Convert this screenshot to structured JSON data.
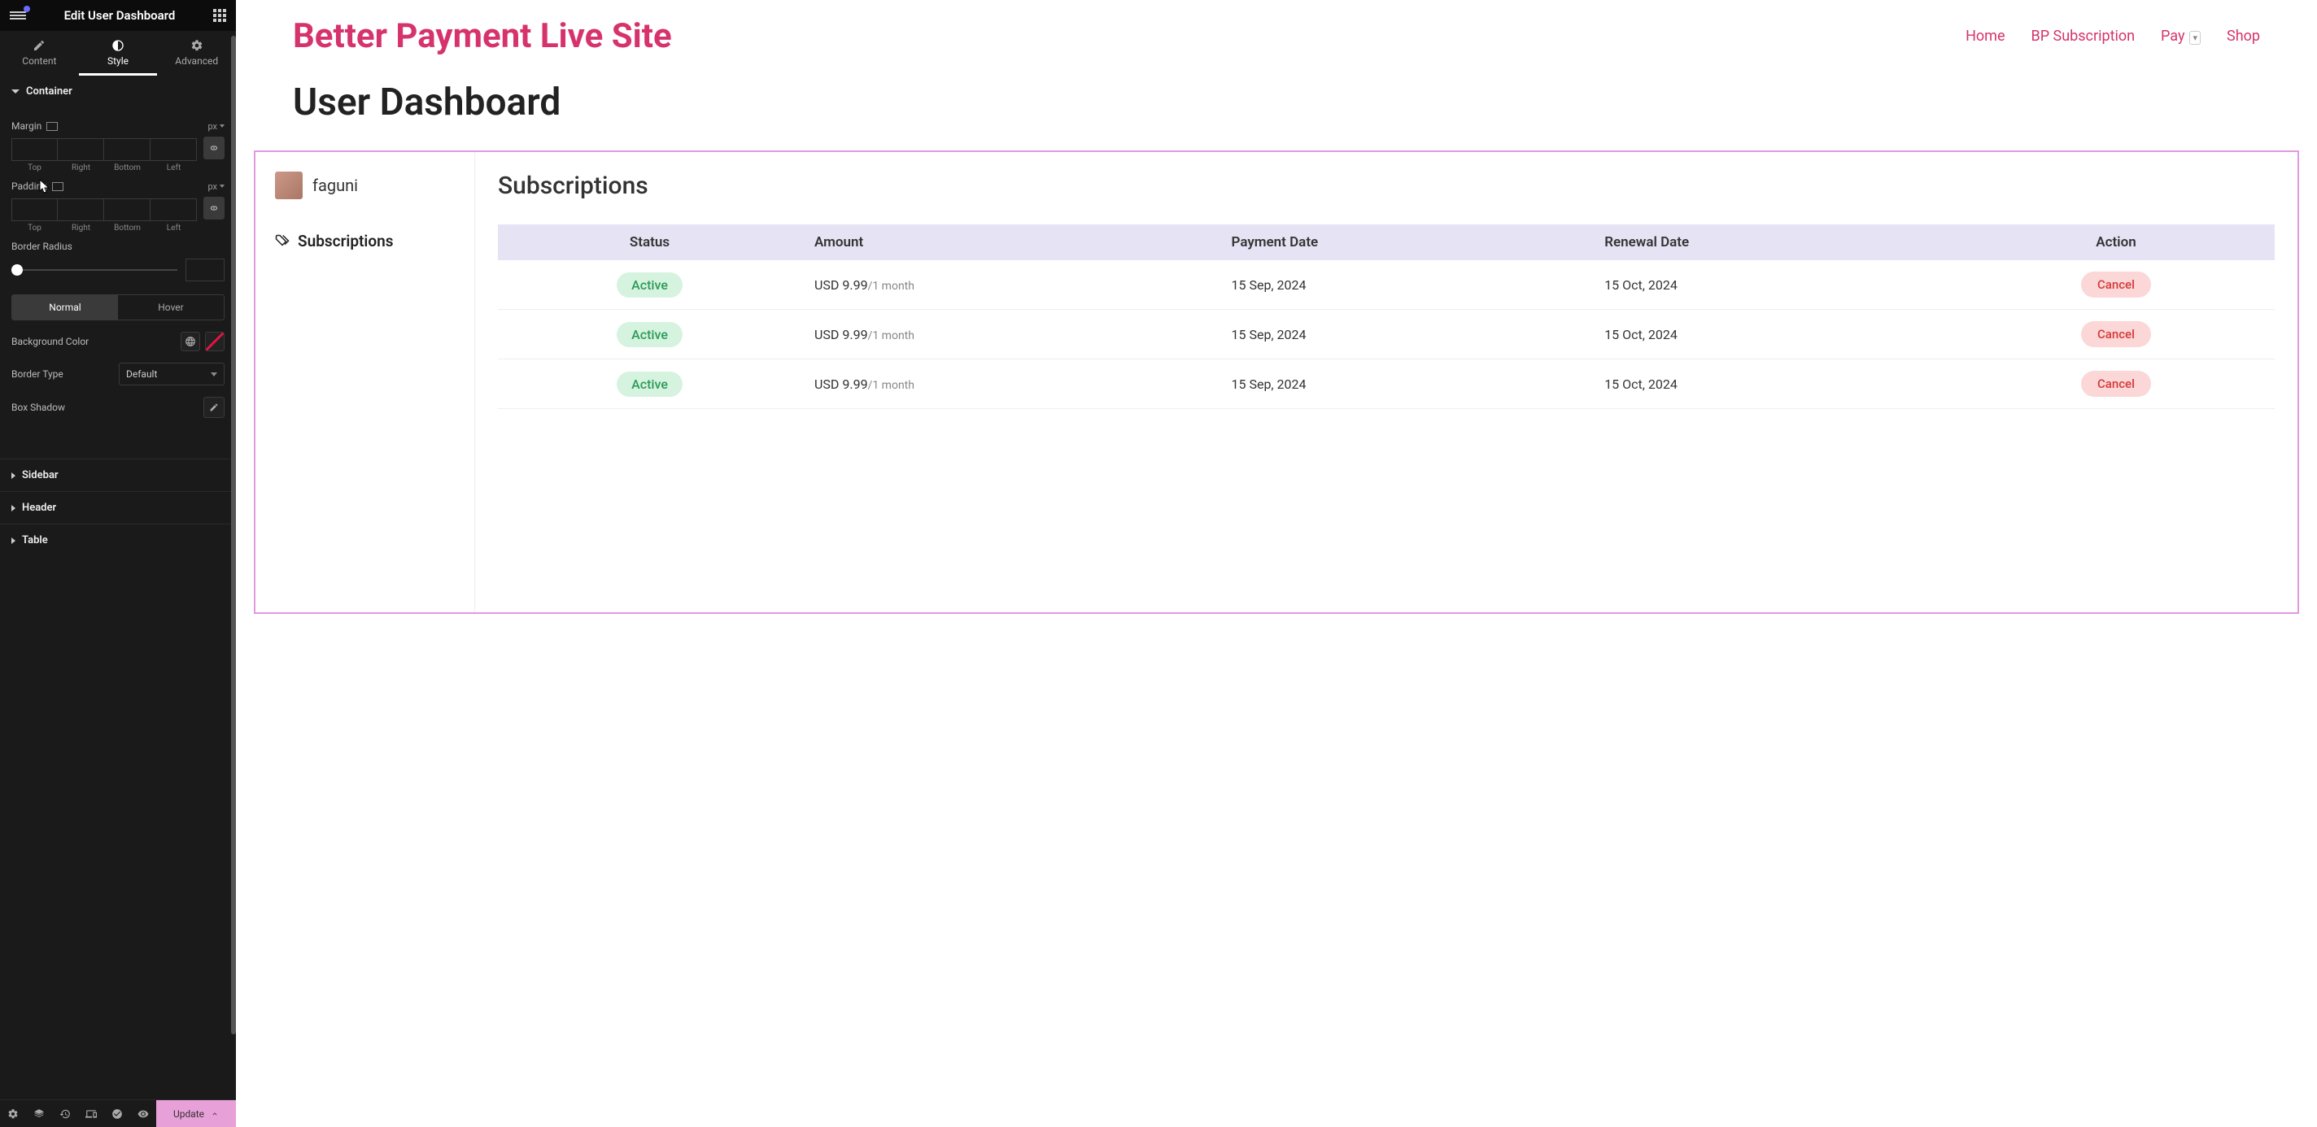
{
  "panel": {
    "title": "Edit User Dashboard",
    "tabs": {
      "content": "Content",
      "style": "Style",
      "advanced": "Advanced"
    },
    "sections": {
      "container": "Container",
      "sidebar": "Sidebar",
      "header": "Header",
      "table": "Table"
    },
    "margin": {
      "label": "Margin",
      "unit": "px",
      "sublabels": [
        "Top",
        "Right",
        "Bottom",
        "Left"
      ]
    },
    "padding": {
      "label": "Padding",
      "unit": "px",
      "sublabels": [
        "Top",
        "Right",
        "Bottom",
        "Left"
      ]
    },
    "border_radius": {
      "label": "Border Radius"
    },
    "state_toggle": {
      "normal": "Normal",
      "hover": "Hover"
    },
    "bg_color": {
      "label": "Background Color"
    },
    "border_type": {
      "label": "Border Type",
      "value": "Default"
    },
    "box_shadow": {
      "label": "Box Shadow"
    },
    "update": "Update"
  },
  "site": {
    "brand": "Better Payment Live Site",
    "nav": [
      "Home",
      "BP Subscription",
      "Pay",
      "Shop"
    ],
    "page_title": "User Dashboard"
  },
  "widget": {
    "user": "faguni",
    "nav_item": "Subscriptions",
    "title": "Subscriptions",
    "headers": [
      "Status",
      "Amount",
      "Payment Date",
      "Renewal Date",
      "Action"
    ],
    "rows": [
      {
        "status": "Active",
        "amount": "USD 9.99",
        "per": "/1 month",
        "pay": "15 Sep, 2024",
        "renew": "15 Oct, 2024",
        "action": "Cancel"
      },
      {
        "status": "Active",
        "amount": "USD 9.99",
        "per": "/1 month",
        "pay": "15 Sep, 2024",
        "renew": "15 Oct, 2024",
        "action": "Cancel"
      },
      {
        "status": "Active",
        "amount": "USD 9.99",
        "per": "/1 month",
        "pay": "15 Sep, 2024",
        "renew": "15 Oct, 2024",
        "action": "Cancel"
      }
    ]
  }
}
